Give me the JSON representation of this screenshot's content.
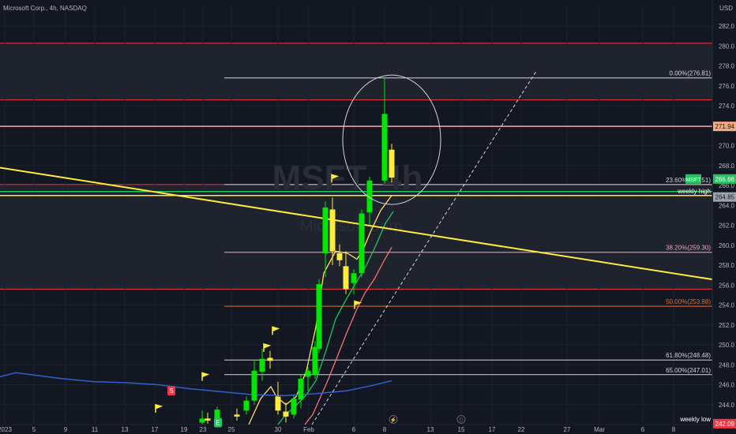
{
  "header": {
    "symbol_title": "Microsoft Corp., 4h, NASDAQ",
    "currency": "USD",
    "watermark_symbol": "MSFT, 4h",
    "watermark_name": "Microsoft Corp"
  },
  "colors": {
    "background": "#131722",
    "grid": "#1e222d",
    "axis_text": "#b2b5be",
    "red_line": "#f23645",
    "yellow": "#ffeb3b",
    "white_line": "#d1d4dc",
    "bull": "#00e600",
    "bear": "#ffeb3b",
    "ma_fast": "#ffe066",
    "ma_mid": "#22c55e",
    "ma_slow": "#f87171",
    "ma_long": "#2f5fd0",
    "fib_orange": "#e0712f"
  },
  "chart_data": {
    "type": "candlestick",
    "ylim": [
      242,
      284
    ],
    "y_ticks": [
      242,
      244,
      246,
      248,
      250,
      252,
      254,
      256,
      258,
      260,
      262,
      264,
      266,
      268,
      270,
      272,
      274,
      276,
      278,
      280,
      282
    ],
    "x_ticks": [
      "2023",
      "5",
      "9",
      "11",
      "13",
      "17",
      "19",
      "23",
      "25",
      "30",
      "Feb",
      "6",
      "8",
      "13",
      "15",
      "17",
      "22",
      "27",
      "Mar",
      "6",
      "8"
    ],
    "price_labels": [
      {
        "text": "271.94",
        "value": 271.94,
        "bg": "#f5a97f",
        "fg": "#131722"
      },
      {
        "text": "266.66",
        "value": 266.66,
        "bg": "#22c55e",
        "fg": "#ffffff"
      },
      {
        "text": "264.85",
        "value": 264.85,
        "bg": "#9ca3af",
        "fg": "#131722"
      },
      {
        "text": "242.09",
        "value": 242.09,
        "bg": "#f23645",
        "fg": "#ffffff"
      }
    ],
    "symbol_tag": "MSFT",
    "zones": [
      {
        "from": 274.6,
        "to": 280.3,
        "color": "#f23645"
      },
      {
        "from": 255.6,
        "to": 266.1,
        "color": "#f23645"
      }
    ],
    "h_lines": [
      {
        "value": 271.94,
        "color": "#f8a5ad"
      },
      {
        "value": 265.0,
        "color": "#ffeb3b"
      },
      {
        "value": 265.4,
        "color": "#22c55e"
      }
    ],
    "fib_levels": [
      {
        "label": "0.00%(276.81)",
        "value": 276.81,
        "color": "#d1d4dc"
      },
      {
        "label": "23.60%(266.51)",
        "value": 266.1,
        "color": "#d1d4dc"
      },
      {
        "label": "38.20%(259.30)",
        "value": 259.3,
        "color": "#f8a5ad"
      },
      {
        "label": "50.00%(253.88)",
        "value": 253.88,
        "color": "#e0712f"
      },
      {
        "label": "61.80%(248.48)",
        "value": 248.48,
        "color": "#d1d4dc"
      },
      {
        "label": "65.00%(247.01)",
        "value": 247.01,
        "color": "#d1d4dc"
      }
    ],
    "annotations": {
      "weekly_high": "weekly high",
      "weekly_low": "weekly low"
    },
    "candles": [
      {
        "x": "Jan 24",
        "open": 242.2,
        "high": 243.4,
        "low": 242.0,
        "close": 242.6
      },
      {
        "x": "Jan 24",
        "open": 242.6,
        "high": 243.2,
        "low": 242.1,
        "close": 242.4
      },
      {
        "x": "Jan 24",
        "open": 242.4,
        "high": 243.8,
        "low": 242.2,
        "close": 243.5
      },
      {
        "x": "Jan 25",
        "open": 243.0,
        "high": 243.6,
        "low": 242.4,
        "close": 242.8
      },
      {
        "x": "Jan 26",
        "open": 243.4,
        "high": 244.8,
        "low": 243.0,
        "close": 244.4
      },
      {
        "x": "Jan 27",
        "open": 244.4,
        "high": 248.5,
        "low": 244.0,
        "close": 247.4
      },
      {
        "x": "Jan 27",
        "open": 247.3,
        "high": 249.6,
        "low": 246.4,
        "close": 248.6
      },
      {
        "x": "Jan 27",
        "open": 248.7,
        "high": 249.4,
        "low": 247.6,
        "close": 248.4
      },
      {
        "x": "Jan 30",
        "open": 244.8,
        "high": 246.3,
        "low": 243.0,
        "close": 243.4
      },
      {
        "x": "Jan 30",
        "open": 243.3,
        "high": 244.2,
        "low": 242.2,
        "close": 242.8
      },
      {
        "x": "Jan 31",
        "open": 243.0,
        "high": 245.0,
        "low": 242.6,
        "close": 244.6
      },
      {
        "x": "Jan 31",
        "open": 244.5,
        "high": 247.0,
        "low": 243.6,
        "close": 246.6
      },
      {
        "x": "Feb 1",
        "open": 246.8,
        "high": 247.8,
        "low": 245.4,
        "close": 247.4
      },
      {
        "x": "Feb 1",
        "open": 247.0,
        "high": 250.4,
        "low": 246.6,
        "close": 249.8
      },
      {
        "x": "Feb 1",
        "open": 249.6,
        "high": 256.6,
        "low": 249.2,
        "close": 256.1
      },
      {
        "x": "Feb 2",
        "open": 259.2,
        "high": 264.4,
        "low": 256.8,
        "close": 263.8
      },
      {
        "x": "Feb 2",
        "open": 263.6,
        "high": 264.8,
        "low": 258.0,
        "close": 259.4
      },
      {
        "x": "Feb 3",
        "open": 259.2,
        "high": 260.1,
        "low": 257.9,
        "close": 258.5
      },
      {
        "x": "Feb 3",
        "open": 257.9,
        "high": 259.4,
        "low": 255.1,
        "close": 255.6
      },
      {
        "x": "Feb 6",
        "open": 256.2,
        "high": 257.6,
        "low": 255.1,
        "close": 257.2
      },
      {
        "x": "Feb 6",
        "open": 257.2,
        "high": 263.6,
        "low": 256.8,
        "close": 263.2
      },
      {
        "x": "Feb 7",
        "open": 263.3,
        "high": 266.9,
        "low": 262.1,
        "close": 266.5
      },
      {
        "x": "Feb 7",
        "open": 266.5,
        "high": 276.81,
        "low": 266.2,
        "close": 273.2
      },
      {
        "x": "Feb 8",
        "open": 269.6,
        "high": 270.2,
        "low": 266.3,
        "close": 266.8
      }
    ],
    "moving_averages": [
      {
        "name": "fast",
        "color": "#ffe066",
        "points": [
          [
            315,
            242.0
          ],
          [
            330,
            244.6
          ],
          [
            343,
            245.8
          ],
          [
            350,
            244.8
          ],
          [
            362,
            244.0
          ],
          [
            375,
            244.8
          ],
          [
            388,
            247.4
          ],
          [
            400,
            251.8
          ],
          [
            410,
            257.2
          ],
          [
            425,
            259.4
          ],
          [
            440,
            259.2
          ],
          [
            452,
            258.6
          ],
          [
            460,
            259.6
          ],
          [
            470,
            261.5
          ],
          [
            482,
            263.5
          ],
          [
            496,
            265.0
          ]
        ]
      },
      {
        "name": "mid",
        "color": "#22c55e",
        "points": [
          [
            352,
            242.0
          ],
          [
            362,
            243.0
          ],
          [
            376,
            244.0
          ],
          [
            388,
            245.0
          ],
          [
            400,
            246.4
          ],
          [
            412,
            249.2
          ],
          [
            425,
            252.6
          ],
          [
            440,
            254.8
          ],
          [
            452,
            256.4
          ],
          [
            464,
            258.0
          ],
          [
            476,
            260.0
          ],
          [
            488,
            262.2
          ],
          [
            498,
            263.4
          ]
        ]
      },
      {
        "name": "slow",
        "color": "#f87171",
        "points": [
          [
            386,
            242.0
          ],
          [
            396,
            243.0
          ],
          [
            406,
            244.8
          ],
          [
            416,
            246.6
          ],
          [
            428,
            249.0
          ],
          [
            440,
            251.4
          ],
          [
            452,
            253.6
          ],
          [
            462,
            255.2
          ],
          [
            474,
            256.6
          ],
          [
            486,
            258.4
          ],
          [
            496,
            259.8
          ]
        ]
      },
      {
        "name": "long",
        "color": "#2f5fd0",
        "points": [
          [
            0,
            246.8
          ],
          [
            20,
            247.2
          ],
          [
            40,
            247.0
          ],
          [
            80,
            246.6
          ],
          [
            120,
            246.3
          ],
          [
            160,
            246.2
          ],
          [
            200,
            246.0
          ],
          [
            240,
            245.6
          ],
          [
            280,
            245.3
          ],
          [
            320,
            245.0
          ],
          [
            360,
            244.9
          ],
          [
            400,
            245.1
          ],
          [
            440,
            245.4
          ],
          [
            470,
            245.9
          ],
          [
            496,
            246.4
          ]
        ]
      }
    ],
    "trendline": {
      "x1": 0,
      "y1": 267.8,
      "x2": 932,
      "y2": 256.2,
      "color": "#ffeb3b"
    },
    "dashed_trendline": {
      "x1": 395,
      "y1": 242.0,
      "x2": 680,
      "y2": 277.6,
      "color": "#d1d4dc"
    },
    "circle_highlight": {
      "cx": 496,
      "cy": 270.6,
      "r": 62,
      "ry": 82
    },
    "flags": [
      {
        "x": 197,
        "value": 243.2,
        "color": "#ffeb3b",
        "type": "flag"
      },
      {
        "x": 217,
        "value": 245.4,
        "color": "#f23645",
        "type": "S"
      },
      {
        "x": 256,
        "value": 246.4,
        "color": "#ffeb3b",
        "type": "flag"
      },
      {
        "x": 276,
        "value": 242.2,
        "color": "#22c55e",
        "type": "E"
      },
      {
        "x": 334,
        "value": 249.3,
        "color": "#ffeb3b",
        "type": "flag"
      },
      {
        "x": 345,
        "value": 251.0,
        "color": "#ffeb3b",
        "type": "flag"
      },
      {
        "x": 420,
        "value": 266.3,
        "color": "#ffeb3b",
        "type": "flag"
      },
      {
        "x": 449,
        "value": 253.6,
        "color": "#ffeb3b",
        "type": "flag"
      }
    ],
    "event_icons": [
      {
        "x": 498,
        "value": 242.2,
        "label": "⚡"
      },
      {
        "x": 584,
        "value": 242.2,
        "label": "D"
      }
    ]
  }
}
